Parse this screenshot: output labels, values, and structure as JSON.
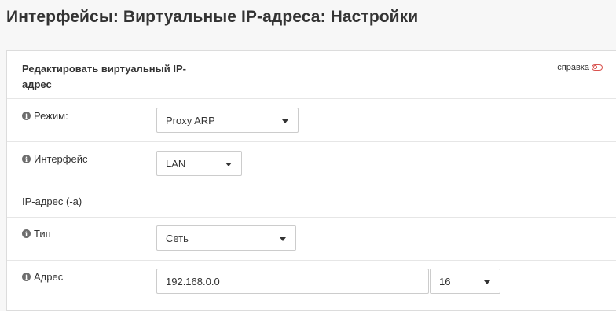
{
  "page": {
    "title": "Интерфейсы: Виртуальные IP-адреса: Настройки"
  },
  "card": {
    "title": "Редактировать виртуальный IP-адрес",
    "help_label": "справка"
  },
  "form": {
    "mode": {
      "label": "Режим:",
      "value": "Proxy ARP"
    },
    "interface": {
      "label": "Интерфейс",
      "value": "LAN"
    },
    "ip_section": {
      "label": "IP-адрес (-а)"
    },
    "type": {
      "label": "Тип",
      "value": "Сеть"
    },
    "address": {
      "label": "Адрес",
      "value": "192.168.0.0",
      "mask": "16"
    }
  }
}
